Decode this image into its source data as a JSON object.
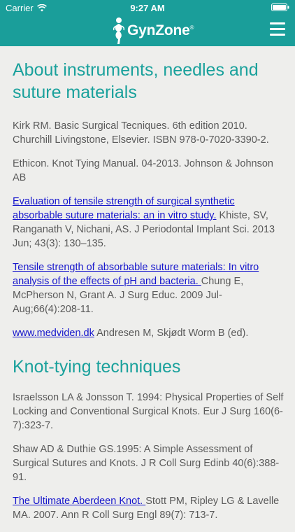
{
  "status_bar": {
    "carrier": "Carrier",
    "time": "9:27 AM",
    "wifi_icon": "wifi-icon",
    "battery_icon": "battery-icon"
  },
  "navbar": {
    "logo_text": "GynZone",
    "logo_mark": "®",
    "menu_icon": "hamburger-menu-icon",
    "header_color": "#1a9e9a"
  },
  "sections": [
    {
      "title": "About instruments, needles and suture materials",
      "references": [
        {
          "link": "",
          "text": "Kirk RM. Basic Surgical Tecniques. 6th edition 2010. Churchill Livingstone, Elsevier. ISBN 978-0-7020-3390-2."
        },
        {
          "link": "",
          "text": "Ethicon. Knot Tying Manual. 04-2013. Johnson & Johnson AB"
        },
        {
          "link": "Evaluation of tensile strength of surgical synthetic absorbable suture materials: an in vitro study.",
          "text": " Khiste, SV, Ranganath V, Nichani, AS. J Periodontal Implant Sci. 2013 Jun; 43(3): 130–135."
        },
        {
          "link": "Tensile strength of absorbable suture materials: In vitro analysis of the effects of pH and bacteria. ",
          "text": "Chung E, McPherson N, Grant A. J Surg Educ. 2009 Jul-Aug;66(4):208-11."
        },
        {
          "link": "www.medviden.dk",
          "text": " Andresen M, Skjødt Worm B (ed)."
        }
      ]
    },
    {
      "title": "Knot-tying techniques",
      "references": [
        {
          "link": "",
          "text": "Israelsson LA & Jonsson T. 1994: Physical Properties of Self Locking and Conventional Surgical Knots. Eur J Surg 160(6-7):323-7."
        },
        {
          "link": "",
          "text": "Shaw AD & Duthie GS.1995: A Simple Assessment of Surgical Sutures and Knots. J R Coll Surg Edinb 40(6):388-91."
        },
        {
          "link": "The Ultimate Aberdeen Knot. ",
          "text": "Stott PM, Ripley LG & Lavelle MA. 2007. Ann R Coll Surg Engl 89(7): 713-7."
        }
      ]
    }
  ]
}
